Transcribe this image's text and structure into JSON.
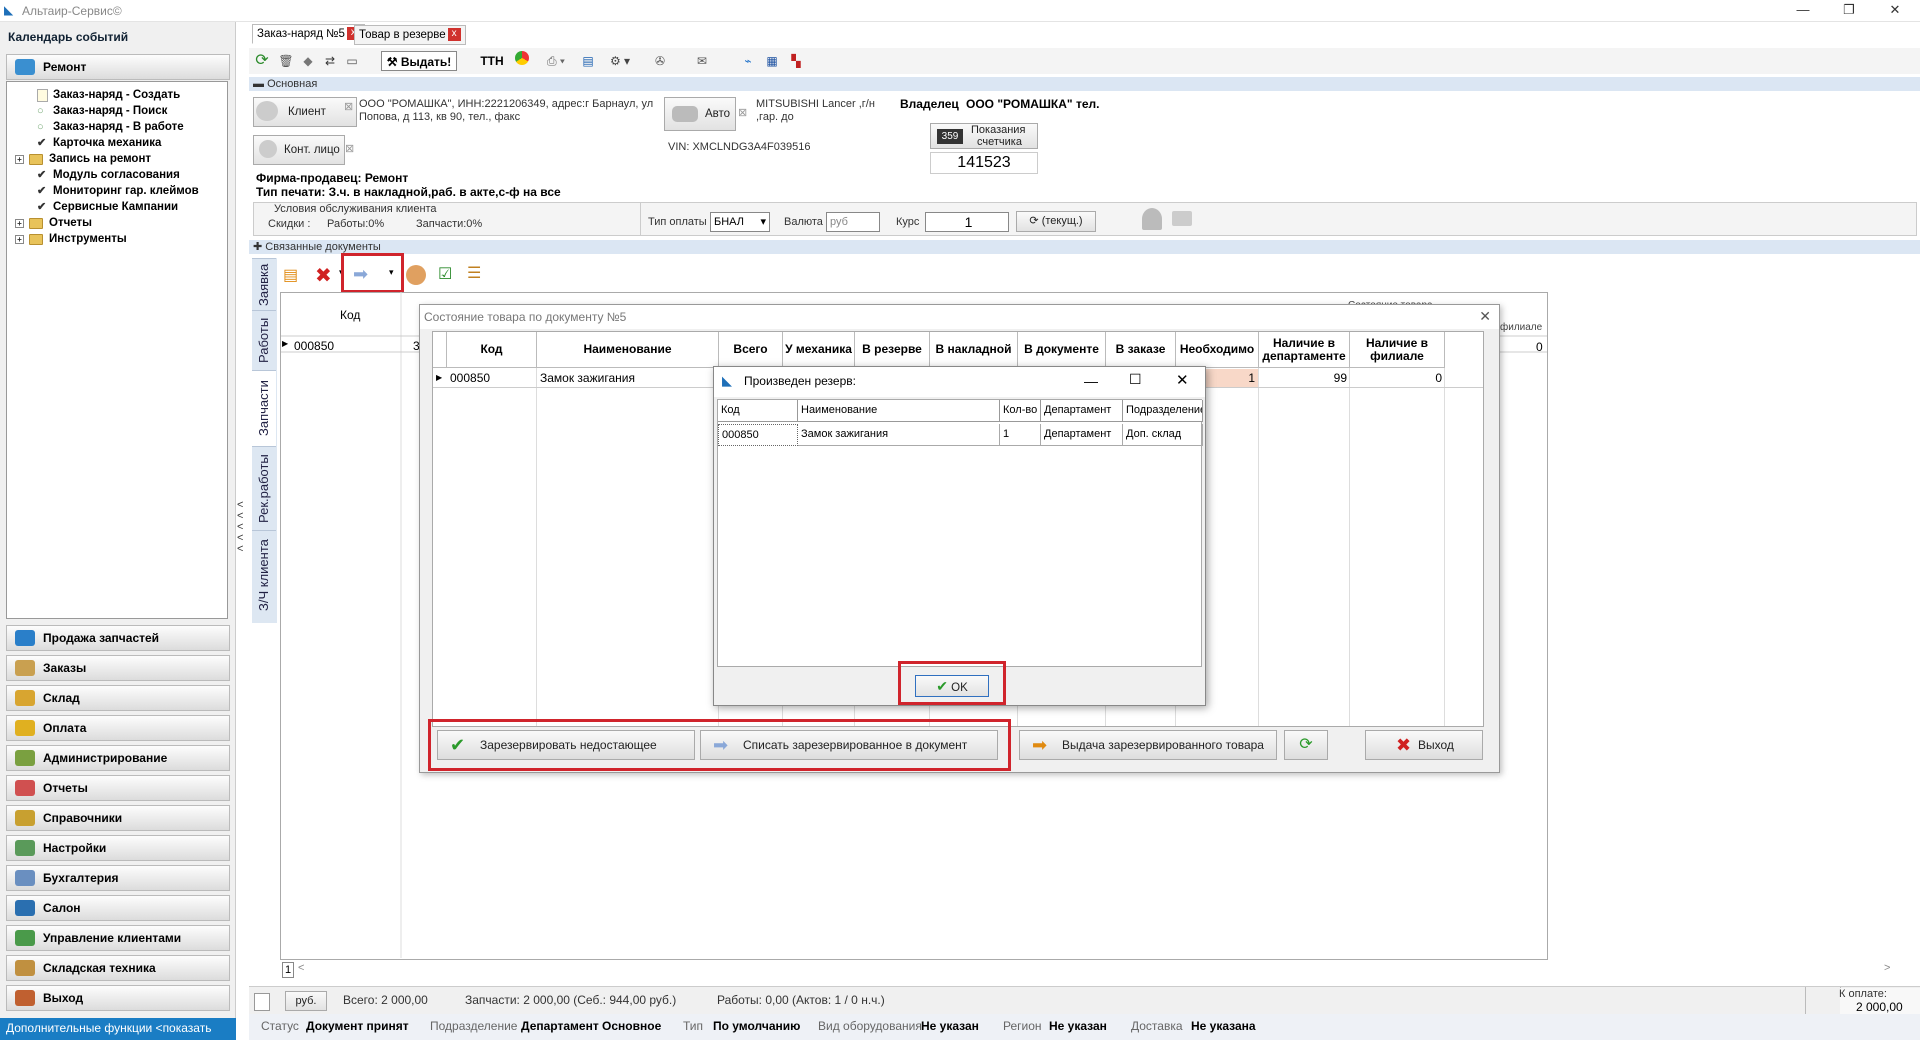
{
  "app": {
    "title": "Альтаир-Сервис©"
  },
  "left_panel": {
    "header": "Календарь событий",
    "active_group": "Ремонт",
    "tree": [
      {
        "label": "Заказ-наряд - Создать",
        "icon": "document-icon",
        "expander": false
      },
      {
        "label": "Заказ-наряд - Поиск",
        "icon": "circle-icon",
        "expander": false
      },
      {
        "label": "Заказ-наряд - В работе",
        "icon": "circle-icon",
        "expander": false
      },
      {
        "label": "Карточка механика",
        "icon": "check-icon",
        "expander": false
      },
      {
        "label": "Запись на ремонт",
        "icon": "folder-icon",
        "expander": true
      },
      {
        "label": "Модуль согласования",
        "icon": "check-icon",
        "expander": false
      },
      {
        "label": "Мониторинг гар. клеймов",
        "icon": "check-icon",
        "expander": false
      },
      {
        "label": "Сервисные Кампании",
        "icon": "check-icon",
        "expander": false
      },
      {
        "label": "Отчеты",
        "icon": "folder-icon",
        "expander": true
      },
      {
        "label": "Инструменты",
        "icon": "folder-icon",
        "expander": true
      }
    ],
    "groups": [
      {
        "label": "Продажа запчастей",
        "color": "#2a7fc9"
      },
      {
        "label": "Заказы",
        "color": "#c9a050"
      },
      {
        "label": "Склад",
        "color": "#d8a530"
      },
      {
        "label": "Оплата",
        "color": "#e0b020"
      },
      {
        "label": "Администрирование",
        "color": "#7aa040"
      },
      {
        "label": "Отчеты",
        "color": "#d05050"
      },
      {
        "label": "Справочники",
        "color": "#c8a030"
      },
      {
        "label": "Настройки",
        "color": "#5a9a5a"
      },
      {
        "label": "Бухгалтерия",
        "color": "#6a8fc0"
      },
      {
        "label": "Салон",
        "color": "#2a6fb0"
      },
      {
        "label": "Управление клиентами",
        "color": "#4a9a4a"
      },
      {
        "label": "Складская техника",
        "color": "#c09040"
      },
      {
        "label": "Выход",
        "color": "#c06030"
      }
    ],
    "bottom_link": "Дополнительные функции <показать"
  },
  "tabs": [
    {
      "label": "Заказ-наряд №5"
    },
    {
      "label": "Товар в резерве"
    }
  ],
  "toolbar": {
    "issue_label": "Выдать!",
    "tth_label": "ТТН"
  },
  "sections": {
    "main": "Основная",
    "related": "Связанные документы"
  },
  "main": {
    "client_btn": "Клиент",
    "client_text_1": "ООО \"РОМАШКА\", ИНН:2221206349, адрес:г Барнаул, ул",
    "client_text_2": "Попова, д 113, кв 90, тел., факс",
    "contact_btn": "Конт. лицо",
    "auto_btn": "Авто",
    "auto_text_1": "MITSUBISHI Lancer ,г/н",
    "auto_text_2": ",гар. до",
    "vin": "VIN: XMCLNDG3A4F039516",
    "owner_label": "Владелец",
    "owner": "ООО \"РОМАШКА\" тел.",
    "counter_badge": "359",
    "counter_label_1": "Показания",
    "counter_label_2": "счетчика",
    "counter_value": "141523",
    "seller": "Фирма-продавец: Ремонт",
    "print_type": "Тип печати: З.ч. в накладной,раб. в акте,с-ф на все"
  },
  "conditions": {
    "title": "Условия обслуживания клиента",
    "discounts_label": "Скидки :",
    "works": "Работы:0%",
    "parts": "Запчасти:0%",
    "pay_type_label": "Тип оплаты",
    "pay_type": "БНАЛ",
    "currency_label": "Валюта",
    "currency": "руб",
    "rate_label": "Курс",
    "rate": "1",
    "current_btn": "(текущ.)"
  },
  "vtabs": [
    "Заявка",
    "Работы",
    "Запчасти",
    "Рек.работы",
    "З/Ч клиента"
  ],
  "grid": {
    "code_header": "Код",
    "state_header": "Состояние товара",
    "branch_header": "филиале",
    "row_code": "000850",
    "row_mark": "3",
    "row_last": "0",
    "row_num": "1"
  },
  "dialog1": {
    "title": "Состояние товара по документу №5",
    "headers": [
      "Код",
      "Наименование",
      "Всего",
      "У механика",
      "В резерве",
      "В накладной",
      "В документе",
      "В заказе",
      "Необходимо",
      "Наличие в департаменте",
      "Наличие в филиале"
    ],
    "row": [
      "000850",
      "Замок зажигания",
      "",
      "",
      "",
      "",
      "",
      "",
      "1",
      "99",
      "0"
    ],
    "buttons": {
      "reserve": "Зарезервировать недостающее",
      "writeoff": "Списать зарезервированное в документ",
      "issue": "Выдача зарезервированного товара",
      "exit": "Выход"
    }
  },
  "dialog2": {
    "title": "Произведен резерв:",
    "headers": [
      "Код",
      "Наименование",
      "Кол-во",
      "Департамент",
      "Подразделение"
    ],
    "row": [
      "000850",
      "Замок зажигания",
      "1",
      "Департамент",
      "Доп. склад"
    ],
    "ok": "OK"
  },
  "totals": {
    "currency_btn": "руб.",
    "total": "Всего: 2 000,00",
    "parts": "Запчасти: 2 000,00 (Себ.: 944,00 руб.)",
    "works": "Работы: 0,00 (Актов: 1 / 0 н.ч.)",
    "to_pay_label": "К оплате:",
    "to_pay": "2 000,00"
  },
  "status": {
    "status_label": "Статус",
    "status": "Документ принят",
    "division_label": "Подразделение",
    "division": "Департамент Основное",
    "type_label": "Тип",
    "type": "По умолчанию",
    "equip_label": "Вид оборудования",
    "equip": "Не указан",
    "region_label": "Регион",
    "region": "Не указан",
    "delivery_label": "Доставка",
    "delivery": "Не указана"
  },
  "colors": {
    "accent": "#1a7dc4",
    "highlight": "#d0242c",
    "needed_cell": "#f8d8c8"
  }
}
